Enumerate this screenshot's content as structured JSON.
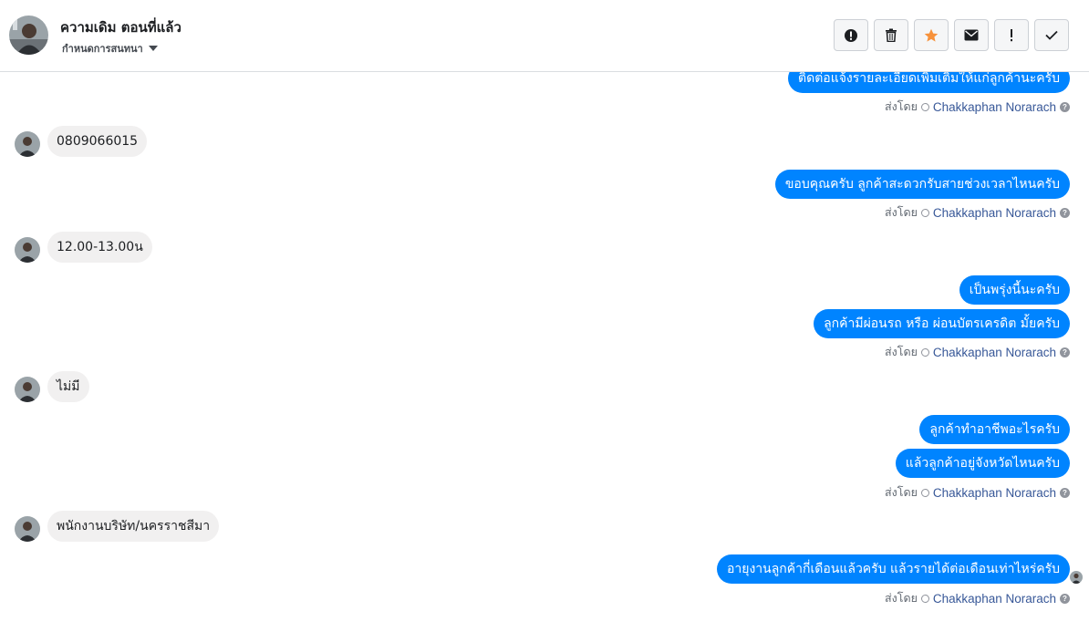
{
  "header": {
    "name": "ความเดิม ตอนที่แล้ว",
    "subtitle": "กำหนดการสนทนา"
  },
  "actions": [
    {
      "icon": "alert-circle-icon"
    },
    {
      "icon": "trash-icon"
    },
    {
      "icon": "star-icon",
      "color": "#f7923b"
    },
    {
      "icon": "envelope-icon"
    },
    {
      "icon": "exclamation-icon"
    },
    {
      "icon": "checkmark-icon"
    }
  ],
  "thread": {
    "sent_by_prefix": "ส่งโดย",
    "agent_name": "Chakkaphan Norarach",
    "messages": {
      "out_1": "ติดต่อแจ้งรายละเอียดเพิ่มเติมให้แก่ลูกค้านะครับ",
      "in_1": "0809066015",
      "out_2": "ขอบคุณครับ ลูกค้าสะดวกรับสายช่วงเวลาไหนครับ",
      "in_2": "12.00-13.00น",
      "out_3a": "เป็นพรุ่งนี้นะครับ",
      "out_3b": "ลูกค้ามีผ่อนรถ หรือ ผ่อนบัตรเครดิต มั้ยครับ",
      "in_3": "ไม่มี",
      "out_4a": "ลูกค้าทำอาชีพอะไรครับ",
      "out_4b": "แล้วลูกค้าอยู่จังหวัดไหนครับ",
      "in_4": "พนักงานบริษัท/นครราชสีมา",
      "out_5": "อายุงานลูกค้ากี่เดือนแล้วครับ แล้วรายได้ต่อเดือนเท่าไหร่ครับ"
    }
  },
  "colors": {
    "outgoing_bubble": "#0084ff",
    "incoming_bubble": "#f1f0f0",
    "agent_link": "#385898"
  }
}
